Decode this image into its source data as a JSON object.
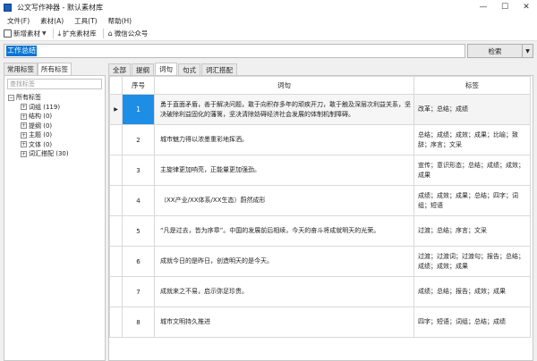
{
  "window": {
    "title": "公文写作神器 - 默认素材库",
    "controls": {
      "minimize": "—",
      "maximize": "☐",
      "close": "✕"
    }
  },
  "menu": [
    "文件(F)",
    "素材(A)",
    "工具(T)",
    "帮助(H)"
  ],
  "toolbar": {
    "new_material": "新增素材",
    "expand_library": "扩充素材库",
    "wechat": "微信公众号"
  },
  "search": {
    "value": "工作总结",
    "button": "检索",
    "dropdown": "▼"
  },
  "left": {
    "tabs": [
      "常用标签",
      "所有标签"
    ],
    "active_tab": 1,
    "filter_placeholder": "查找标签",
    "tree_root": "所有标签",
    "tree_items": [
      "词组 (119)",
      "结构 (0)",
      "提纲 (0)",
      "主题 (0)",
      "文体 (0)",
      "词汇搭配 (30)"
    ]
  },
  "right": {
    "tabs": [
      "全部",
      "提纲",
      "词句",
      "句式",
      "词汇搭配"
    ],
    "active_tab": 2,
    "columns": [
      "序号",
      "词句",
      "标签"
    ],
    "rows": [
      {
        "num": "1",
        "text": "勇于直面矛盾，善于解决问题，敢于向积存多年的顽疾开刀，敢于触及深层次利益关系，坚决破除利益固化的藩篱，坚决清除妨碍经济社会发展的体制机制障碍。",
        "tags": "改革；总结；成绩"
      },
      {
        "num": "2",
        "text": "城市魅力得以浓墨重彩地挥洒。",
        "tags": "总结；成绩；成效；成果；比喻；致辞；序言；文采"
      },
      {
        "num": "3",
        "text": "主旋律更加响亮，正能量更加强劲。",
        "tags": "宣传；意识形态；总结；成绩；成效；成果"
      },
      {
        "num": "4",
        "text": "（XX产业/XX体系/XX生态）蔚然成形",
        "tags": "成绩；成效；成果；总结；四字；词组；短语"
      },
      {
        "num": "5",
        "text": "“凡是过去，皆为序章”。中国的发展前后相续，今天的奋斗将成就明天的光荣。",
        "tags": "过渡；总结；序言；文采"
      },
      {
        "num": "6",
        "text": "成就今日的是昨日，创造明天的是今天。",
        "tags": "过渡；过渡词；过渡句；报告；总结；成绩；成效；成果"
      },
      {
        "num": "7",
        "text": "成就来之不易，启示弥足珍贵。",
        "tags": "成绩；总结；报告；成效；成果"
      },
      {
        "num": "8",
        "text": "城市文明持久推进",
        "tags": "四字；短语；词组；总结；成绩"
      }
    ]
  }
}
